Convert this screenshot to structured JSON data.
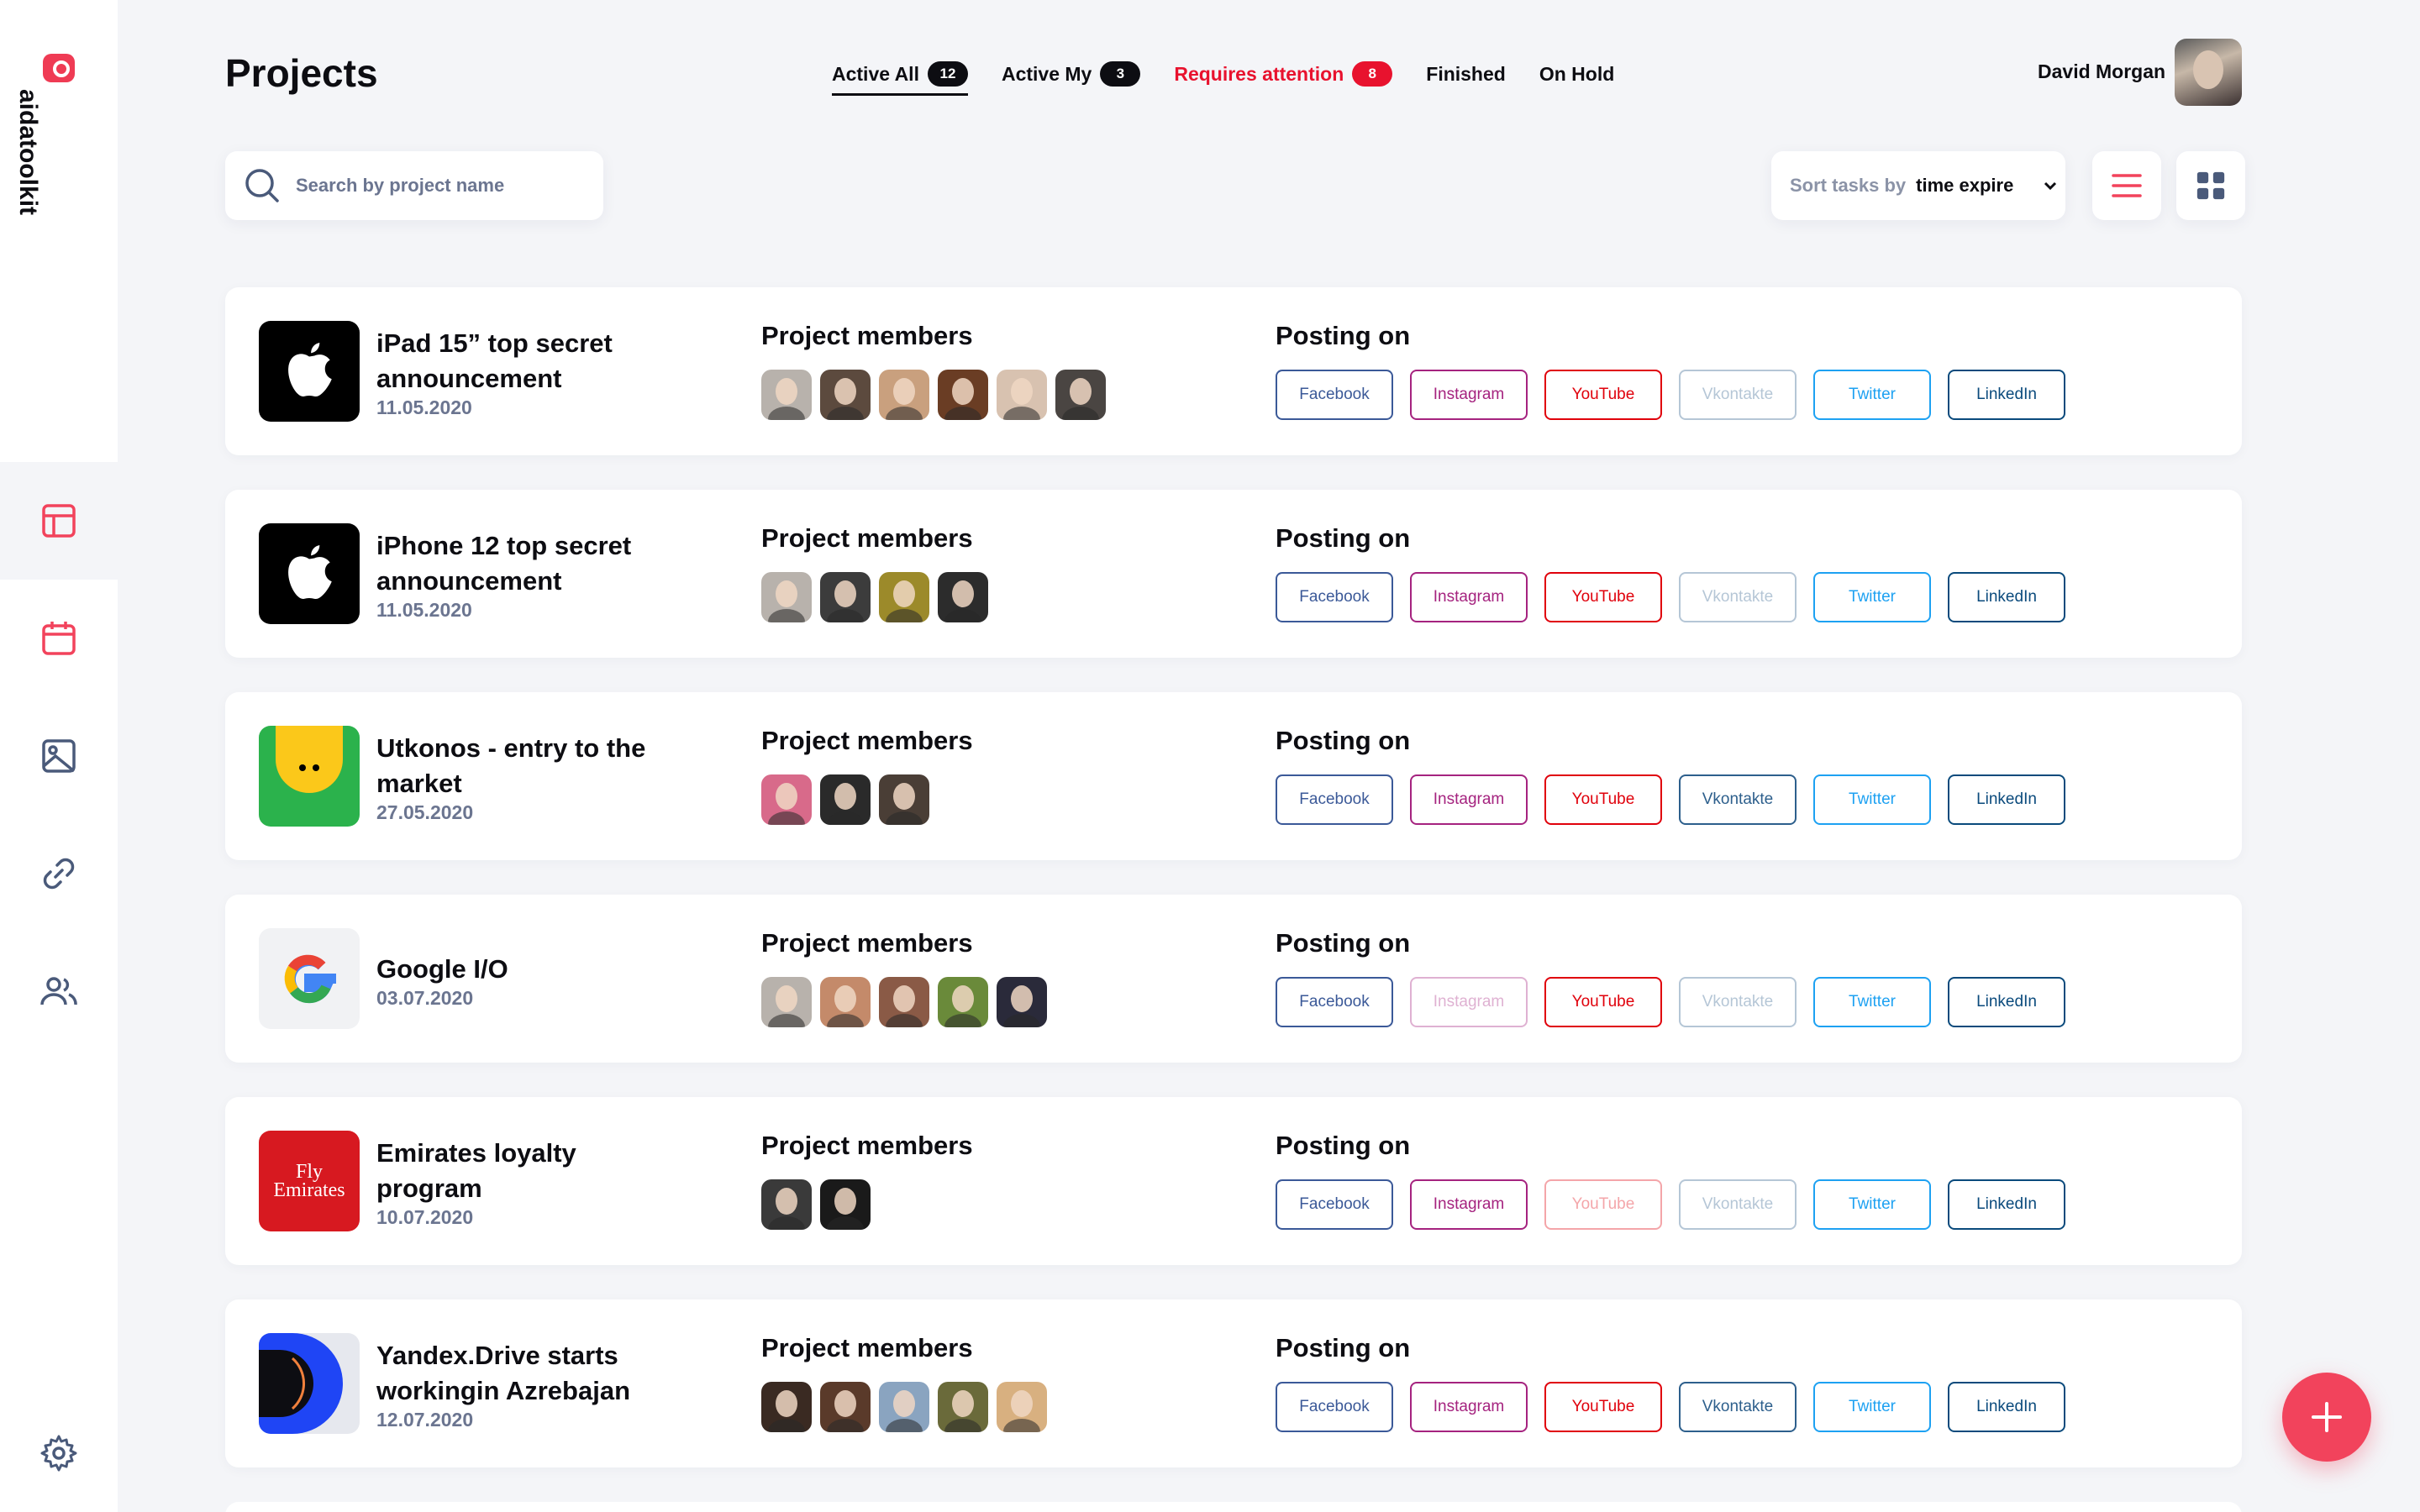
{
  "app": {
    "brand": "aidatoolkit",
    "title": "Projects"
  },
  "tabs": [
    {
      "label": "Active All",
      "count": "12",
      "active": true,
      "alert": false
    },
    {
      "label": "Active My",
      "count": "3",
      "active": false,
      "alert": false
    },
    {
      "label": "Requires attention",
      "count": "8",
      "active": false,
      "alert": true
    },
    {
      "label": "Finished",
      "count": "",
      "active": false,
      "alert": false
    },
    {
      "label": "On Hold",
      "count": "",
      "active": false,
      "alert": false
    }
  ],
  "user": {
    "name": "David Morgan"
  },
  "search": {
    "placeholder": "Search by project name",
    "value": ""
  },
  "sort": {
    "prefix": "Sort tasks by",
    "value": "time expire"
  },
  "labels": {
    "members": "Project members",
    "posting": "Posting on"
  },
  "colors": {
    "accent": "#f2435c",
    "alert": "#e8122e",
    "facebook": "#3b5998",
    "instagram": "#a5237f",
    "youtube": "#e0000b",
    "vkontakte": "#2d5f8c",
    "twitter": "#1da1f2",
    "linkedin": "#0a4a7c"
  },
  "networks": [
    "Facebook",
    "Instagram",
    "YouTube",
    "Vkontakte",
    "Twitter",
    "LinkedIn"
  ],
  "projects": [
    {
      "title": "iPad 15” top secret announcement",
      "date": "11.05.2020",
      "logo": "apple-logo",
      "members": [
        "#b8b2ac",
        "#5c4a3e",
        "#c9a07e",
        "#6a3d24",
        "#d8c2b0",
        "#4a4542"
      ],
      "enabled": [
        true,
        true,
        true,
        false,
        true,
        true
      ]
    },
    {
      "title": "iPhone 12 top secret announcement",
      "date": "11.05.2020",
      "logo": "apple-logo",
      "members": [
        "#b8b2ac",
        "#3c3c3c",
        "#9c8a2a",
        "#2c2c2c"
      ],
      "enabled": [
        true,
        true,
        true,
        false,
        true,
        true
      ]
    },
    {
      "title": "Utkonos - entry to the market",
      "date": "27.05.2020",
      "logo": "utkonos-logo",
      "members": [
        "#d86a8a",
        "#2a2a2a",
        "#4a3e36"
      ],
      "enabled": [
        true,
        true,
        true,
        true,
        true,
        true
      ]
    },
    {
      "title": "Google I/O",
      "date": "03.07.2020",
      "logo": "google-logo",
      "members": [
        "#b8b2ac",
        "#c48a6a",
        "#8a5a46",
        "#6a8a3a",
        "#2a2a3a"
      ],
      "enabled": [
        true,
        false,
        true,
        false,
        true,
        true
      ]
    },
    {
      "title": "Emirates loyalty program",
      "date": "10.07.2020",
      "logo": "emirates-logo",
      "logo_text": "Fly Emirates",
      "members": [
        "#3a3a3a",
        "#1a1a1a"
      ],
      "enabled": [
        true,
        true,
        false,
        false,
        true,
        true
      ]
    },
    {
      "title": "Yandex.Drive starts workingin Azrebajan",
      "date": "12.07.2020",
      "logo": "yandex-drive-logo",
      "members": [
        "#3a2a22",
        "#5a3a2a",
        "#8aa4c0",
        "#6a6a3a",
        "#d8b080"
      ],
      "enabled": [
        true,
        true,
        true,
        true,
        true,
        true
      ]
    }
  ]
}
